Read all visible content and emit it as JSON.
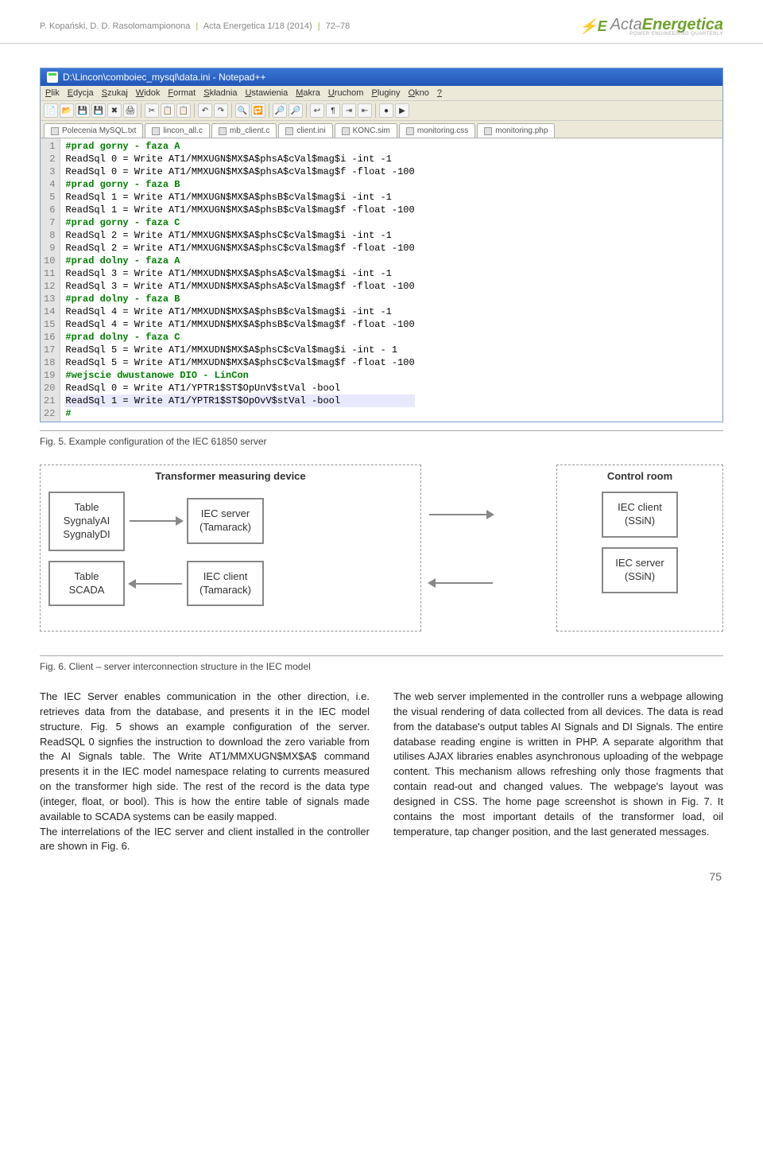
{
  "header": {
    "authors": "P. Kopański, D. D. Rasolomampionona",
    "journal": "Acta Energetica 1/18 (2014)",
    "pages": "72–78",
    "logo_acta": "Acta",
    "logo_energ": "Energetica",
    "logo_sub": "POWER ENGINEERING QUARTERLY"
  },
  "npp": {
    "title": "D:\\Lincon\\comboiec_mysql\\data.ini - Notepad++",
    "menu": [
      "Plik",
      "Edycja",
      "Szukaj",
      "Widok",
      "Format",
      "Składnia",
      "Ustawienia",
      "Makra",
      "Uruchom",
      "Pluginy",
      "Okno",
      "?"
    ],
    "tabs": [
      "Polecenia MySQL.txt",
      "lincon_all.c",
      "mb_client.c",
      "client.ini",
      "KONC.sim",
      "monitoring.css",
      "monitoring.php"
    ],
    "lines": [
      {
        "n": 1,
        "t": "#prad gorny - faza A",
        "c": "comment"
      },
      {
        "n": 2,
        "t": "ReadSql 0 = Write AT1/MMXUGN$MX$A$phsA$cVal$mag$i -int -1"
      },
      {
        "n": 3,
        "t": "ReadSql 0 = Write AT1/MMXUGN$MX$A$phsA$cVal$mag$f -float -100"
      },
      {
        "n": 4,
        "t": "#prad gorny - faza B",
        "c": "comment"
      },
      {
        "n": 5,
        "t": "ReadSql 1 = Write AT1/MMXUGN$MX$A$phsB$cVal$mag$i -int -1"
      },
      {
        "n": 6,
        "t": "ReadSql 1 = Write AT1/MMXUGN$MX$A$phsB$cVal$mag$f -float -100"
      },
      {
        "n": 7,
        "t": "#prad gorny - faza C",
        "c": "comment"
      },
      {
        "n": 8,
        "t": "ReadSql 2 = Write AT1/MMXUGN$MX$A$phsC$cVal$mag$i -int -1"
      },
      {
        "n": 9,
        "t": "ReadSql 2 = Write AT1/MMXUGN$MX$A$phsC$cVal$mag$f -float -100"
      },
      {
        "n": 10,
        "t": "#prad dolny - faza A",
        "c": "comment"
      },
      {
        "n": 11,
        "t": "ReadSql 3 = Write AT1/MMXUDN$MX$A$phsA$cVal$mag$i -int -1"
      },
      {
        "n": 12,
        "t": "ReadSql 3 = Write AT1/MMXUDN$MX$A$phsA$cVal$mag$f -float -100"
      },
      {
        "n": 13,
        "t": "#prad dolny - faza B",
        "c": "comment"
      },
      {
        "n": 14,
        "t": "ReadSql 4 = Write AT1/MMXUDN$MX$A$phsB$cVal$mag$i -int -1"
      },
      {
        "n": 15,
        "t": "ReadSql 4 = Write AT1/MMXUDN$MX$A$phsB$cVal$mag$f -float -100"
      },
      {
        "n": 16,
        "t": "#prad dolny - faza C",
        "c": "comment"
      },
      {
        "n": 17,
        "t": "ReadSql 5 = Write AT1/MMXUDN$MX$A$phsC$cVal$mag$i -int - 1"
      },
      {
        "n": 18,
        "t": "ReadSql 5 = Write AT1/MMXUDN$MX$A$phsC$cVal$mag$f -float -100"
      },
      {
        "n": 19,
        "t": "#wejscie dwustanowe DIO - LinCon",
        "c": "comment"
      },
      {
        "n": 20,
        "t": "ReadSql 0 = Write AT1/YPTR1$ST$OpUnV$stVal -bool"
      },
      {
        "n": 21,
        "t": "ReadSql 1 = Write AT1/YPTR1$ST$OpOvV$stVal -bool",
        "caret": true
      },
      {
        "n": 22,
        "t": "#",
        "c": "comment"
      }
    ]
  },
  "fig5": "Fig. 5. Example configuration of the IEC 61850 server",
  "diagram": {
    "left_title": "Transformer measuring device",
    "right_title": "Control room",
    "box1": "Table\nSygnalyAI\nSygnalyDI",
    "box2": "IEC server\n(Tamarack)",
    "box3": "IEC client\n(SSiN)",
    "box4": "Table\nSCADA",
    "box5": "IEC client\n(Tamarack)",
    "box6": "IEC server\n(SSiN)"
  },
  "fig6": "Fig. 6. Client – server interconnection structure in the IEC model",
  "col1": "The IEC Server enables communication in the other direction, i.e. retrieves data from the database, and presents it in the IEC model structure. Fig. 5 shows an example configuration of the server. ReadSQL 0 signfies the instruction to download the zero variable from the AI Signals table. The Write AT1/MMXUGN$MX$A$ command presents it in the IEC model namespace relating to currents measured on the transformer high side. The rest of the record is the data type (integer, float, or bool). This is how the entire table of signals made available to SCADA systems can be easily mapped.\nThe interrelations of the IEC server and client installed in the controller are shown in Fig. 6.",
  "col2": "The web server implemented in the controller runs a webpage allowing the visual rendering of data collected from all devices. The data is read from the database's output tables AI Signals and DI Signals. The entire database reading engine is written in PHP. A separate algorithm that utilises AJAX libraries enables asynchronous uploading of the webpage content. This mechanism allows refreshing only those fragments that contain read-out and changed values. The webpage's layout was designed in CSS. The home page screenshot is shown in Fig. 7. It contains the most important details of the transformer load, oil temperature, tap changer position, and the last generated messages.",
  "page_num": "75"
}
